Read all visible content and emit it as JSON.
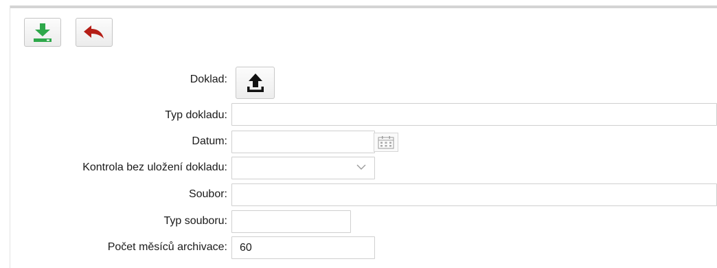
{
  "toolbar": {
    "save_icon": "download-save-icon",
    "save_color": "#2ea84a",
    "back_icon": "undo-arrow-icon",
    "back_color": "#b51e16"
  },
  "form": {
    "doklad": {
      "label": "Doklad:",
      "icon": "upload-icon"
    },
    "typ_dokladu": {
      "label": "Typ dokladu:",
      "value": ""
    },
    "datum": {
      "label": "Datum:",
      "value": "",
      "icon": "calendar-icon"
    },
    "kontrola": {
      "label": "Kontrola bez uložení dokladu:",
      "selected": "",
      "icon": "chevron-down-icon"
    },
    "soubor": {
      "label": "Soubor:",
      "value": ""
    },
    "typ_souboru": {
      "label": "Typ souboru:",
      "value": ""
    },
    "pocet_mesicu": {
      "label": "Počet měsíců archivace:",
      "value": "60"
    }
  }
}
